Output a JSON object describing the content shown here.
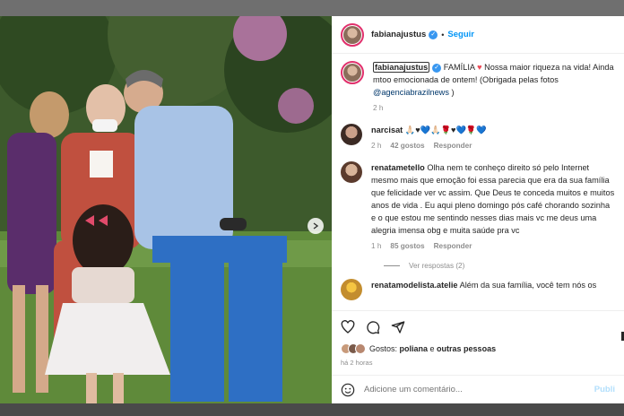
{
  "post": {
    "author": "fabianajustus",
    "follow_label": "Seguir",
    "caption_user": "fabianajustus",
    "caption_text_1": " FAMÍLIA ",
    "caption_heart": "♥",
    "caption_text_2": " Nossa maior riqueza na vida! Ainda mtoo emocionada de ontem! (Obrigada pelas fotos ",
    "caption_mention": "@agenciabrazilnews",
    "caption_text_3": " )",
    "caption_time": "2 h"
  },
  "comments": [
    {
      "user": "narcisat",
      "text": "🙏🏻♥💙🙏🏻🌹♥💙🌹💙",
      "time": "2 h",
      "likes": "42 gostos",
      "reply": "Responder"
    },
    {
      "user": "renatametello",
      "text": "Olha nem te conheço direito só pelo Internet mesmo mais que emoção foi essa parecia que era da sua família que felicidade ver vc assim. Que Deus te conceda muitos e muitos anos de vida . Eu aqui pleno domingo pós café chorando sozinha e o que estou me sentindo nesses dias mais vc me deus uma alegria imensa obg e muita saúde pra vc",
      "time": "1 h",
      "likes": "85 gostos",
      "reply": "Responder",
      "view_replies": "Ver respostas (2)"
    },
    {
      "user": "renatamodelista.atelie",
      "text": "Além da sua família, você tem nós os"
    }
  ],
  "footer": {
    "likes_prefix": "Gostos: ",
    "likes_user": "poliana",
    "likes_mid": " e ",
    "likes_others": "outras pessoas",
    "time_ago": "há 2 horas",
    "comment_placeholder": "Adicione um comentário...",
    "publish_label": "Publi"
  },
  "colors": {
    "accent": "#0095f6",
    "heart": "#ed4956",
    "verified": "#3897f0"
  },
  "icons": [
    "verified-icon",
    "heart-icon",
    "comment-icon",
    "share-icon",
    "emoji-icon",
    "next-arrow-icon"
  ]
}
